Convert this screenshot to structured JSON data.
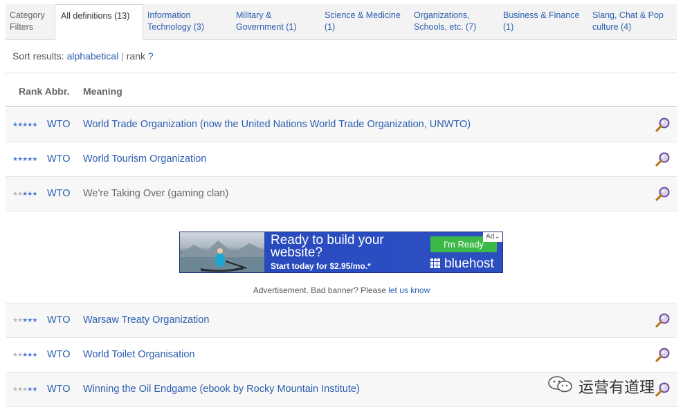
{
  "tabs": {
    "filters_label": "Category\nFilters",
    "items": [
      {
        "label": "All definitions (13)"
      },
      {
        "label": "Information Technology (3)"
      },
      {
        "label": "Military & Government (1)"
      },
      {
        "label": "Science & Medicine (1)"
      },
      {
        "label": "Organizations, Schools, etc. (7)"
      },
      {
        "label": "Business & Finance (1)"
      },
      {
        "label": "Slang, Chat & Pop culture (4)"
      }
    ]
  },
  "sort": {
    "prefix": "Sort results:",
    "alphabetical": "alphabetical",
    "separator": "|",
    "rank": "rank",
    "help": "?"
  },
  "table": {
    "headers": {
      "rank_abbr": "Rank Abbr.",
      "meaning": "Meaning"
    },
    "rows_top": [
      {
        "stars": 5,
        "abbr": "WTO",
        "meaning": "World Trade Organization (now the United Nations World Trade Organization, UNWTO)"
      },
      {
        "stars": 5,
        "abbr": "WTO",
        "meaning": "World Tourism Organization"
      },
      {
        "stars": 3,
        "abbr": "WTO",
        "meaning": "We're Taking Over (gaming clan)"
      }
    ],
    "rows_bottom": [
      {
        "stars": 3,
        "abbr": "WTO",
        "meaning": "Warsaw Treaty Organization"
      },
      {
        "stars": 3,
        "abbr": "WTO",
        "meaning": "World Toilet Organisation"
      },
      {
        "stars": 2,
        "abbr": "WTO",
        "meaning": "Winning the Oil Endgame (ebook by Rocky Mountain Institute)"
      }
    ]
  },
  "ad": {
    "headline": "Ready to build your website?",
    "subline": "Start today for $2.95/mo.*",
    "cta": "I'm Ready",
    "brand": "bluehost",
    "badge": "Ad"
  },
  "ad_note": {
    "text": "Advertisement. Bad banner? Please",
    "link": "let us know"
  },
  "watermark": {
    "text": "运营有道理"
  },
  "icons": {
    "magnifier": "magnifier-icon",
    "star": "star-icon"
  },
  "colors": {
    "link": "#2a5db0",
    "star_on": "#4a78d8",
    "star_off": "#b5b5b5",
    "cta_green": "#3db94a",
    "ad_blue": "#2b4dc2"
  }
}
